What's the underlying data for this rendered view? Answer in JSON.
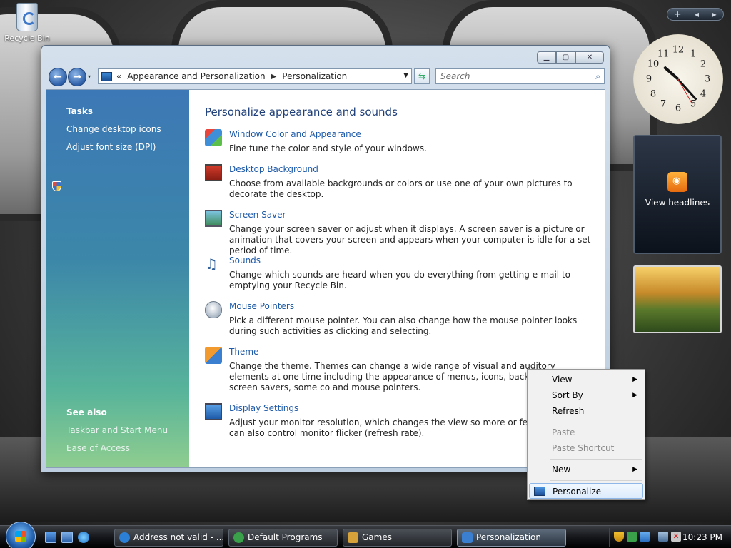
{
  "desktop": {
    "recycle_bin_label": "Recycle Bin"
  },
  "window": {
    "caption_buttons": {
      "minimize": "▁",
      "maximize": "▢",
      "close": "✕"
    },
    "nav": {
      "back": "←",
      "forward": "→",
      "recent": "▾"
    },
    "address": {
      "prefix": "«",
      "crumbs": [
        "Appearance and Personalization",
        "Personalization"
      ]
    },
    "refresh_glyph": "⇆",
    "search": {
      "placeholder": "Search",
      "icon": "search-icon"
    }
  },
  "sidebar": {
    "tasks_heading": "Tasks",
    "tasks": [
      {
        "label": "Change desktop icons"
      },
      {
        "label": "Adjust font size (DPI)",
        "icon": "shield-icon"
      }
    ],
    "see_also_heading": "See also",
    "see_also": [
      {
        "label": "Taskbar and Start Menu"
      },
      {
        "label": "Ease of Access"
      }
    ]
  },
  "main": {
    "title": "Personalize appearance and sounds",
    "items": [
      {
        "icon": "window-color-icon",
        "label": "Window Color and Appearance",
        "desc": "Fine tune the color and style of your windows."
      },
      {
        "icon": "desktop-background-icon",
        "label": "Desktop Background",
        "desc": "Choose from available backgrounds or colors or use one of your own pictures to decorate the desktop."
      },
      {
        "icon": "screen-saver-icon",
        "label": "Screen Saver",
        "desc": "Change your screen saver or adjust when it displays. A screen saver is a picture or animation that covers your screen and appears when your computer is idle for a set period of time."
      },
      {
        "icon": "sounds-icon",
        "label": "Sounds",
        "desc": "Change which sounds are heard when you do everything from getting e-mail to emptying your Recycle Bin."
      },
      {
        "icon": "mouse-pointers-icon",
        "label": "Mouse Pointers",
        "desc": "Pick a different mouse pointer. You can also change how the mouse pointer looks during such activities as clicking and selecting."
      },
      {
        "icon": "theme-icon",
        "label": "Theme",
        "desc": "Change the theme. Themes can change a wide range of visual and auditory elements at one time including the appearance of menus, icons, backgrounds, screen savers, some co and mouse pointers."
      },
      {
        "icon": "display-settings-icon",
        "label": "Display Settings",
        "desc": "Adjust your monitor resolution, which changes the view so more or fewer items You can also control monitor flicker (refresh rate)."
      }
    ]
  },
  "context_menu": {
    "items": [
      {
        "label": "View",
        "submenu": true,
        "enabled": true
      },
      {
        "label": "Sort By",
        "submenu": true,
        "enabled": true
      },
      {
        "label": "Refresh",
        "submenu": false,
        "enabled": true
      },
      {
        "label": "Paste",
        "submenu": false,
        "enabled": false
      },
      {
        "label": "Paste Shortcut",
        "submenu": false,
        "enabled": false
      },
      {
        "label": "New",
        "submenu": true,
        "enabled": true
      },
      {
        "label": "Personalize",
        "submenu": false,
        "enabled": true,
        "highlighted": true
      }
    ],
    "submenu_arrow": "▶"
  },
  "gadgets": {
    "bar": {
      "add": "+",
      "prev": "◂",
      "next": "▸"
    },
    "clock_numbers": [
      "12",
      "1",
      "2",
      "3",
      "4",
      "5",
      "6",
      "7",
      "8",
      "9",
      "10",
      "11"
    ],
    "feed_label": "View headlines"
  },
  "taskbar": {
    "buttons": [
      {
        "label": "Address not valid - ...",
        "icon": "internet-explorer-icon",
        "color": "#2b7fd6"
      },
      {
        "label": "Default Programs",
        "icon": "default-programs-icon",
        "color": "#3aa04a"
      },
      {
        "label": "Games",
        "icon": "games-icon",
        "color": "#d8a23a"
      },
      {
        "label": "Personalization",
        "icon": "control-panel-icon",
        "color": "#3b7fd0",
        "active": true
      }
    ],
    "clock": "10:23 PM"
  }
}
